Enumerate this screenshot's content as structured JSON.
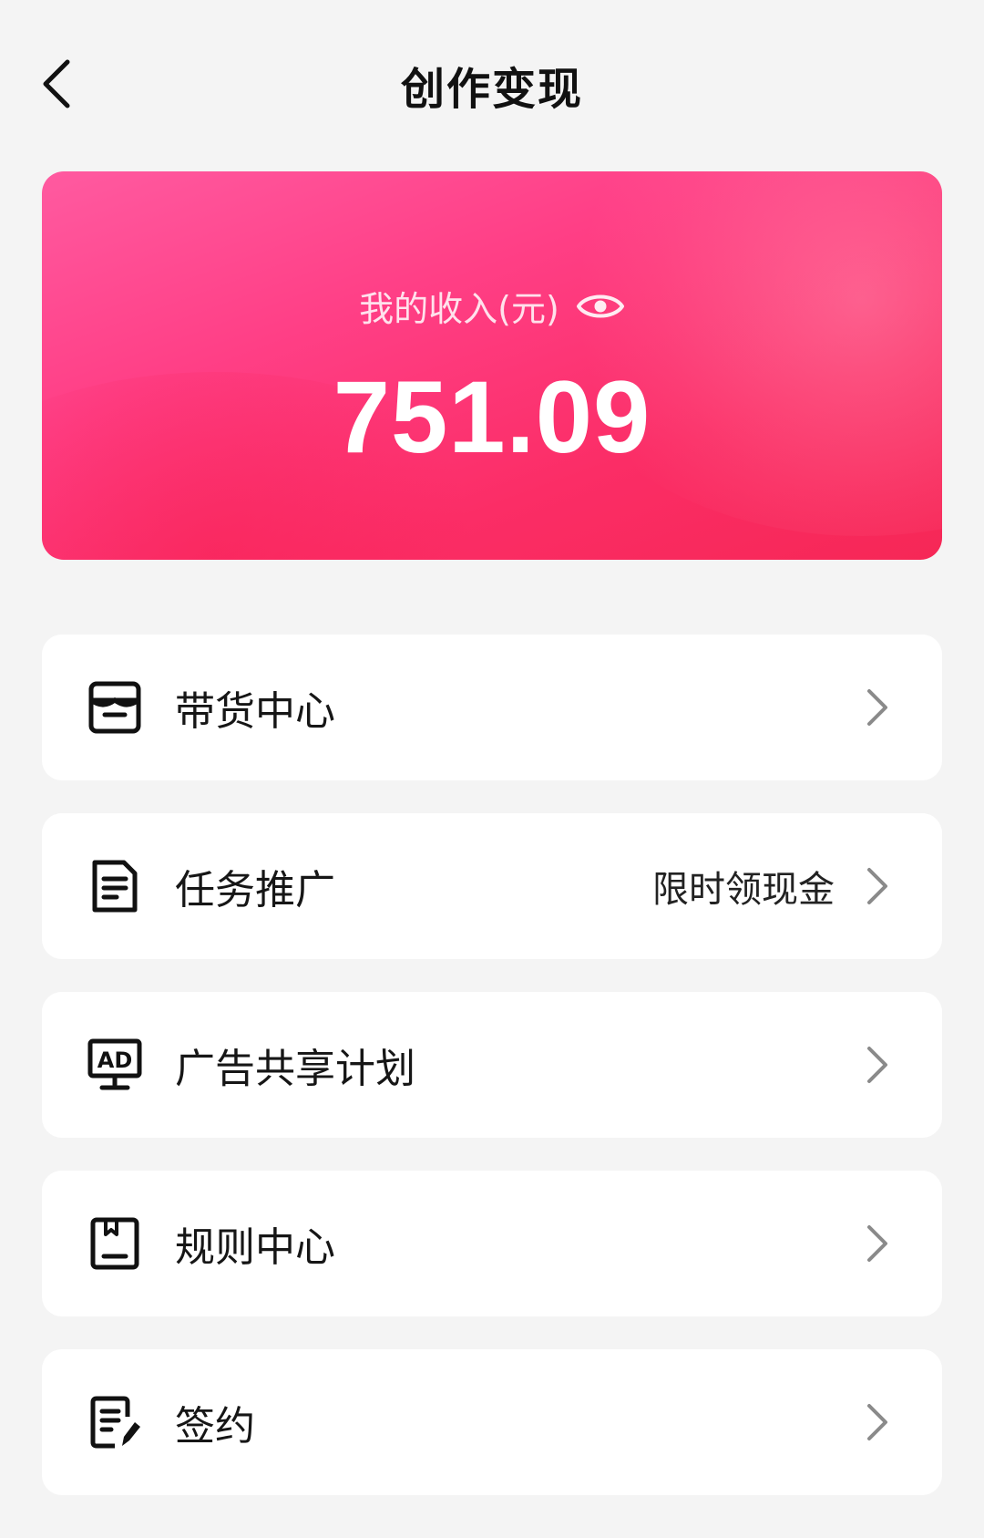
{
  "header": {
    "title": "创作变现",
    "back_icon": "chevron-left-icon"
  },
  "income": {
    "label": "我的收入(元)",
    "value": "751.09",
    "toggle_icon": "eye-icon",
    "gradient_colors": [
      "#ff5aa0",
      "#fb2d66",
      "#f62756"
    ]
  },
  "menu": {
    "items": [
      {
        "label": "带货中心",
        "icon": "store-icon",
        "extra": ""
      },
      {
        "label": "任务推广",
        "icon": "document-icon",
        "extra": "限时领现金"
      },
      {
        "label": "广告共享计划",
        "icon": "ad-monitor-icon",
        "extra": ""
      },
      {
        "label": "规则中心",
        "icon": "rules-book-icon",
        "extra": ""
      },
      {
        "label": "签约",
        "icon": "sign-contract-icon",
        "extra": ""
      }
    ],
    "chevron_icon": "chevron-right-icon"
  }
}
